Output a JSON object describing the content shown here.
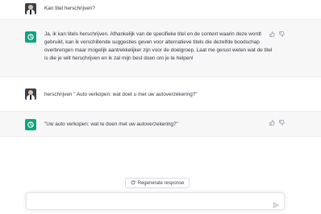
{
  "conversation": {
    "messages": [
      {
        "role": "user",
        "text": "Kan titel herschrijven?"
      },
      {
        "role": "assistant",
        "text": "Ja, ik kan titels herschrijven. Afhankelijk van de specifieke titel en de context waarin deze wordt gebruikt, kan ik verschillende suggesties geven voor alternatieve titels die dezelfde boodschap overbrengen maar mogelijk aantrekkelijker zijn voor de doelgroep. Laat me gerust weten wat de titel is die je wilt herschrijven en ik zal mijn best doen om je te helpen!"
      },
      {
        "role": "user",
        "text": "herschrijven \" Auto verkopen: wat doet u met uw autoverzekering?\""
      },
      {
        "role": "assistant",
        "text": "\"Uw auto verkopen: wat te doen met uw autoverzekering?\""
      }
    ]
  },
  "composer": {
    "regenerate_label": "Regenerate response",
    "input_value": "",
    "input_placeholder": ""
  },
  "icons": {
    "thumbs_up": "thumbs-up-icon",
    "thumbs_down": "thumbs-down-icon",
    "regenerate": "refresh-icon",
    "send": "send-icon",
    "assistant_logo": "openai-logo-icon"
  },
  "colors": {
    "assistant_bg": "#f7f7f8",
    "brand_green": "#10a37f",
    "text": "#343541"
  }
}
